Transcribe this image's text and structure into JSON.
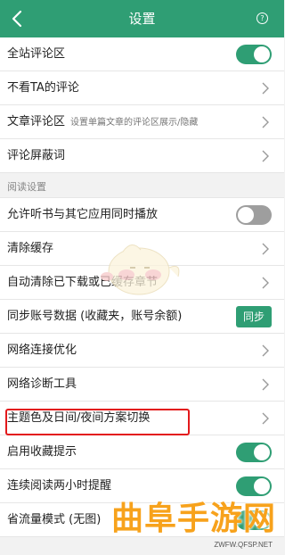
{
  "header": {
    "title": "设置",
    "help_glyph": "?",
    "background": "#2f9e74"
  },
  "rows": [
    {
      "label": "全站评论区",
      "control": "toggle",
      "on": true
    },
    {
      "label": "不看TA的评论",
      "control": "chevron"
    },
    {
      "label": "文章评论区",
      "sub": "设置单篇文章的评论区展示/隐藏",
      "control": "chevron"
    },
    {
      "label": "评论屏蔽词",
      "control": "chevron"
    },
    {
      "label": "阅读设置",
      "section": true
    },
    {
      "label": "允许听书与其它应用同时播放",
      "control": "toggle",
      "on": false
    },
    {
      "label": "清除缓存",
      "control": "chevron"
    },
    {
      "label": "自动清除已下载或已缓存章节",
      "control": "chevron"
    },
    {
      "label": "同步账号数据 (收藏夹，账号余额)",
      "control": "button",
      "button_label": "同步"
    },
    {
      "label": "网络连接优化",
      "control": "chevron"
    },
    {
      "label": "网络诊断工具",
      "control": "chevron"
    },
    {
      "label": "主题色及日间/夜间方案切换",
      "control": "chevron",
      "highlighted": true
    },
    {
      "label": "启用收藏提示",
      "control": "toggle",
      "on": true
    },
    {
      "label": "连续阅读两小时提醒",
      "control": "toggle",
      "on": true
    },
    {
      "label": "省流量模式 (无图)",
      "control": "toggle",
      "on": true
    }
  ],
  "watermark": {
    "text": "曲阜手游网",
    "url_text": "ZWFW.QFSP.NET",
    "color": "#f7a21c"
  },
  "colors": {
    "accent": "#2f9e74",
    "toggle_off": "#9e9e9e",
    "highlight_box": "#e3191b"
  }
}
